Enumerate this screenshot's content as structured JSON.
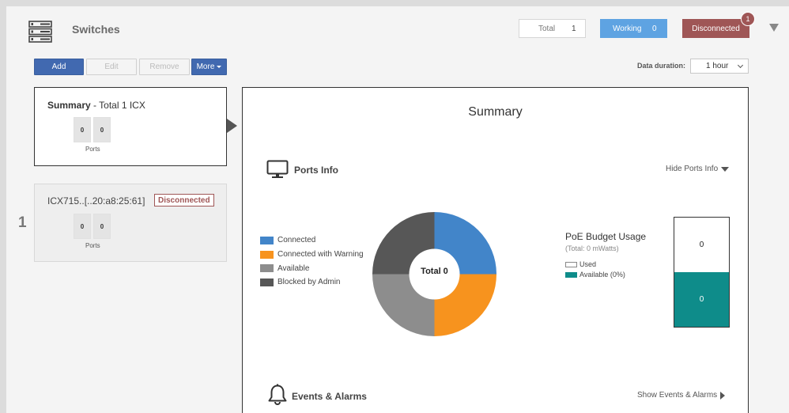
{
  "header": {
    "title": "Switches",
    "stats": {
      "total_label": "Total",
      "total_value": "1",
      "working_label": "Working",
      "working_value": "0",
      "disconnected_label": "Disconnected",
      "disconnected_badge": "1"
    }
  },
  "toolbar": {
    "add_label": "Add",
    "edit_label": "Edit",
    "remove_label": "Remove",
    "more_label": "More"
  },
  "data_duration": {
    "label": "Data duration:",
    "value": "1 hour"
  },
  "summary_card": {
    "title_bold": "Summary",
    "title_rest": " - Total 1 ICX",
    "ports": [
      "0",
      "0"
    ],
    "ports_label": "Ports"
  },
  "device_card": {
    "index": "1",
    "name": "ICX715..[..20:a8:25:61]",
    "status": "Disconnected",
    "ports": [
      "0",
      "0"
    ],
    "ports_label": "Ports"
  },
  "panel": {
    "title": "Summary",
    "ports_info": {
      "title": "Ports Info",
      "toggle_label": "Hide Ports Info",
      "legend": [
        {
          "label": "Connected",
          "color": "#4285c9"
        },
        {
          "label": "Connected with Warning",
          "color": "#f7931e"
        },
        {
          "label": "Available",
          "color": "#8d8d8d"
        },
        {
          "label": "Blocked by Admin",
          "color": "#575757"
        }
      ],
      "donut_center_label": "Total 0"
    },
    "poe": {
      "title": "PoE Budget Usage",
      "subtitle": "(Total: 0 mWatts)",
      "used_label": "Used",
      "available_label": "Available (0%)",
      "used_value": "0",
      "available_value": "0",
      "used_color": "#ffffff",
      "available_color": "#0e8c8a"
    },
    "events": {
      "title": "Events & Alarms",
      "toggle_label": "Show Events & Alarms"
    }
  }
}
